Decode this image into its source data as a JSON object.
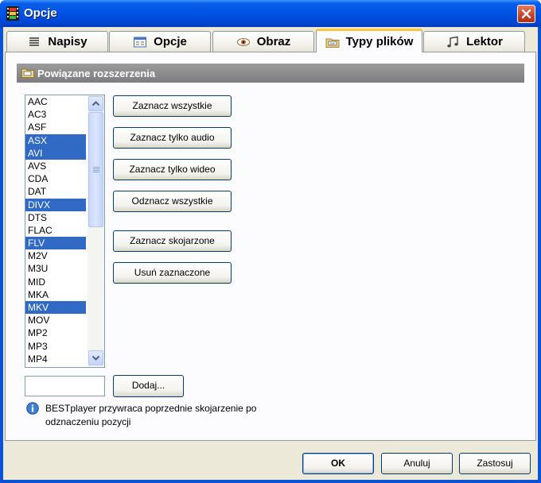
{
  "window": {
    "title": "Opcje",
    "close_icon": "close-icon"
  },
  "tabs": [
    {
      "label": "Napisy",
      "icon": "text-lines-icon",
      "active": false
    },
    {
      "label": "Opcje",
      "icon": "window-settings-icon",
      "active": false
    },
    {
      "label": "Obraz",
      "icon": "eye-icon",
      "active": false
    },
    {
      "label": "Typy plików",
      "icon": "folder-files-icon",
      "active": true
    },
    {
      "label": "Lektor",
      "icon": "music-note-icon",
      "active": false
    }
  ],
  "section": {
    "title": "Powiązane rozszerzenia",
    "icon": "folder-icon"
  },
  "extensions": [
    {
      "name": "AAC",
      "selected": false
    },
    {
      "name": "AC3",
      "selected": false
    },
    {
      "name": "ASF",
      "selected": false
    },
    {
      "name": "ASX",
      "selected": true
    },
    {
      "name": "AVI",
      "selected": true
    },
    {
      "name": "AVS",
      "selected": false
    },
    {
      "name": "CDA",
      "selected": false
    },
    {
      "name": "DAT",
      "selected": false
    },
    {
      "name": "DIVX",
      "selected": true
    },
    {
      "name": "DTS",
      "selected": false
    },
    {
      "name": "FLAC",
      "selected": false
    },
    {
      "name": "FLV",
      "selected": true
    },
    {
      "name": "M2V",
      "selected": false
    },
    {
      "name": "M3U",
      "selected": false
    },
    {
      "name": "MID",
      "selected": false
    },
    {
      "name": "MKA",
      "selected": false
    },
    {
      "name": "MKV",
      "selected": true
    },
    {
      "name": "MOV",
      "selected": false
    },
    {
      "name": "MP2",
      "selected": false
    },
    {
      "name": "MP3",
      "selected": false
    },
    {
      "name": "MP4",
      "selected": false
    }
  ],
  "buttons": {
    "select_all": "Zaznacz wszystkie",
    "select_audio": "Zaznacz tylko audio",
    "select_video": "Zaznacz tylko wideo",
    "deselect_all": "Odznacz wszystkie",
    "select_associated": "Zaznacz skojarzone",
    "remove_selected": "Usuń zaznaczone",
    "add": "Dodaj..."
  },
  "add_input": {
    "value": ""
  },
  "info": {
    "text": "BESTplayer przywraca poprzednie skojarzenie po odznaczeniu pozycji",
    "icon": "info-icon"
  },
  "footer": {
    "ok": "OK",
    "cancel": "Anuluj",
    "apply": "Zastosuj"
  },
  "colors": {
    "selection": "#316AC5",
    "titlebar": "#0055E5",
    "dialog_bg": "#ECE9D8",
    "active_tab_accent": "#FFC83C",
    "section_bar": "#858585"
  }
}
